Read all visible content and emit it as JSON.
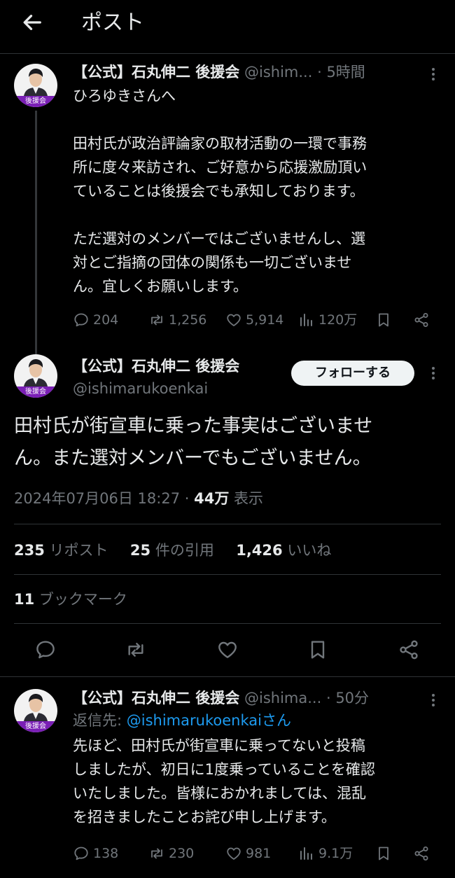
{
  "header": {
    "title": "ポスト"
  },
  "tweet1": {
    "name": "【公式】石丸伸二 後援会",
    "handle": "@ishim...",
    "time": "· 5時間",
    "avatar_badge": "後援会",
    "text": "ひろゆきさんへ\n\n田村氏が政治評論家の取材活動の一環で事務\n所に度々来訪され、ご好意から応援激励頂い\nていることは後援会でも承知しております。\n\nただ選対のメンバーではございませんし、選\n対とご指摘の団体の関係も一切ございませ\nん。宜しくお願いします。",
    "replies": "204",
    "reposts": "1,256",
    "likes": "5,914",
    "views": "120万"
  },
  "main": {
    "name": "【公式】石丸伸二 後援会",
    "handle": "@ishimarukoenkai",
    "avatar_badge": "後援会",
    "follow_label": "フォローする",
    "text": "田村氏が街宣車に乗った事実はございませ\nん。また選対メンバーでもございません。",
    "datetime": "2024年07月06日 18:27 · ",
    "views_count": "44万",
    "views_label": " 表示",
    "reposts_count": "235",
    "reposts_label": " リポスト",
    "quotes_count": "25",
    "quotes_label": " 件の引用",
    "likes_count": "1,426",
    "likes_label": " いいね",
    "bookmarks_count": "11",
    "bookmarks_label": " ブックマーク"
  },
  "tweet3": {
    "name": "【公式】石丸伸二 後援会",
    "handle": "@ishima...",
    "time": "· 50分",
    "avatar_badge": "後援会",
    "reply_to_prefix": "返信先: ",
    "reply_to_handle": "@ishimarukoenkaiさん",
    "text": "先ほど、田村氏が街宣車に乗ってないと投稿\nしましたが、初日に1度乗っていることを確認\nいたしました。皆様におかれましては、混乱\nを招きましたことお詫び申し上げます。",
    "replies": "138",
    "reposts": "230",
    "likes": "981",
    "views": "9.1万"
  },
  "icons": {
    "back": "arrow-left-icon",
    "more": "more-vertical-icon",
    "reply": "reply-icon",
    "repost": "repost-icon",
    "like": "heart-icon",
    "views": "views-icon",
    "bookmark": "bookmark-icon",
    "share": "share-icon"
  },
  "colors": {
    "background": "#000000",
    "text": "#e7e9ea",
    "muted": "#71767b",
    "link": "#1d9bf0",
    "avatar_band": "#7a1fb5"
  }
}
